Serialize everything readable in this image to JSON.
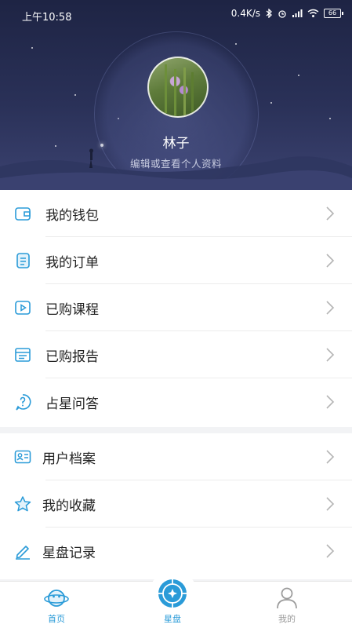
{
  "status_bar": {
    "time": "上午10:58",
    "network_speed": "0.4K/s",
    "battery": "66"
  },
  "profile": {
    "name": "林子",
    "subtitle": "编辑或查看个人资料"
  },
  "menu_section_1": [
    {
      "label": "我的钱包",
      "icon": "wallet-icon"
    },
    {
      "label": "我的订单",
      "icon": "order-icon"
    },
    {
      "label": "已购课程",
      "icon": "course-icon"
    },
    {
      "label": "已购报告",
      "icon": "report-icon"
    },
    {
      "label": "占星问答",
      "icon": "question-icon"
    }
  ],
  "menu_section_2": [
    {
      "label": "用户档案",
      "icon": "profile-card-icon"
    },
    {
      "label": "我的收藏",
      "icon": "star-icon"
    },
    {
      "label": "星盘记录",
      "icon": "pencil-icon"
    }
  ],
  "bottom_nav": {
    "home": "首页",
    "chart": "星盘",
    "mine": "我的"
  },
  "colors": {
    "accent": "#2a9bd8",
    "header_dark": "#1e2444",
    "inactive": "#9a9a9a"
  }
}
